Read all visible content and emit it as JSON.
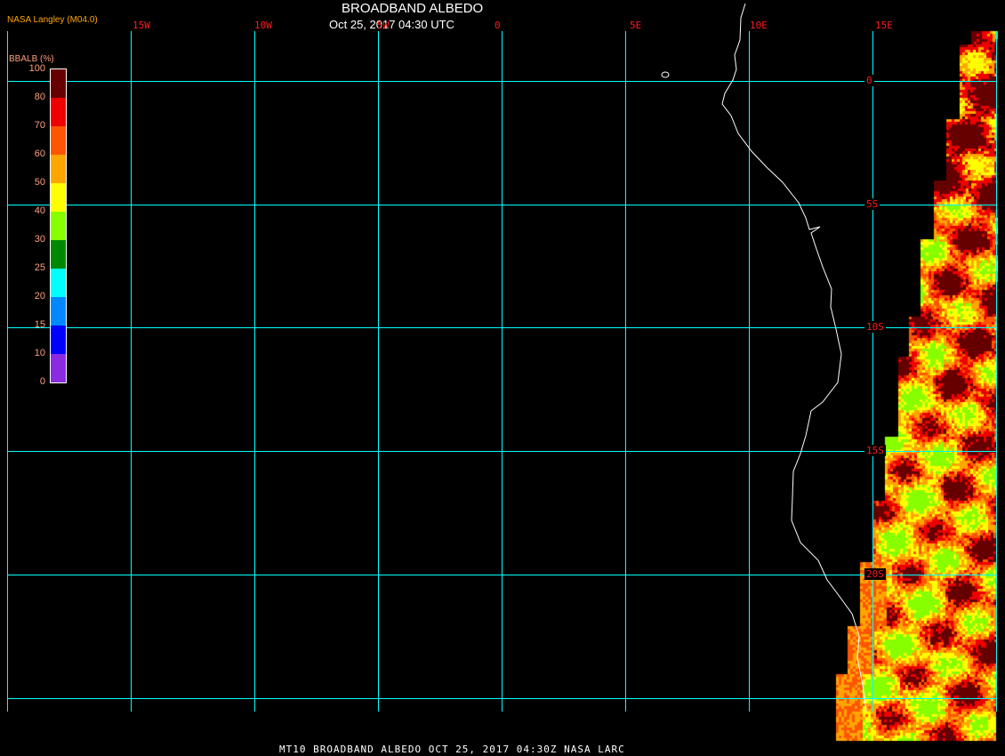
{
  "header": {
    "title": "BROADBAND ALBEDO",
    "subtitle": "Oct 25, 2017 04:30 UTC",
    "credit": "NASA Langley (M04.0)"
  },
  "grid": {
    "lon_labels": [
      "15W",
      "10W",
      "5W",
      "0",
      "5E",
      "10E",
      "15E"
    ],
    "lat_labels": [
      "0",
      "5S",
      "10S",
      "15S",
      "20S"
    ],
    "line_color": "#00ffff",
    "label_color": "#ff1a1a"
  },
  "legend": {
    "title": "BBALB (%)",
    "ticks": [
      "100",
      "80",
      "70",
      "60",
      "50",
      "40",
      "30",
      "25",
      "20",
      "15",
      "10",
      "0"
    ],
    "colors": [
      "#660000",
      "#ee0000",
      "#ff5500",
      "#ffa500",
      "#ffff00",
      "#88ff00",
      "#008800",
      "#00ffff",
      "#0088ff",
      "#0000ff",
      "#8a2be2"
    ]
  },
  "footer": {
    "text": "MT10  BROADBAND ALBEDO   OCT 25, 2017 04:30Z   NASA LARC"
  }
}
